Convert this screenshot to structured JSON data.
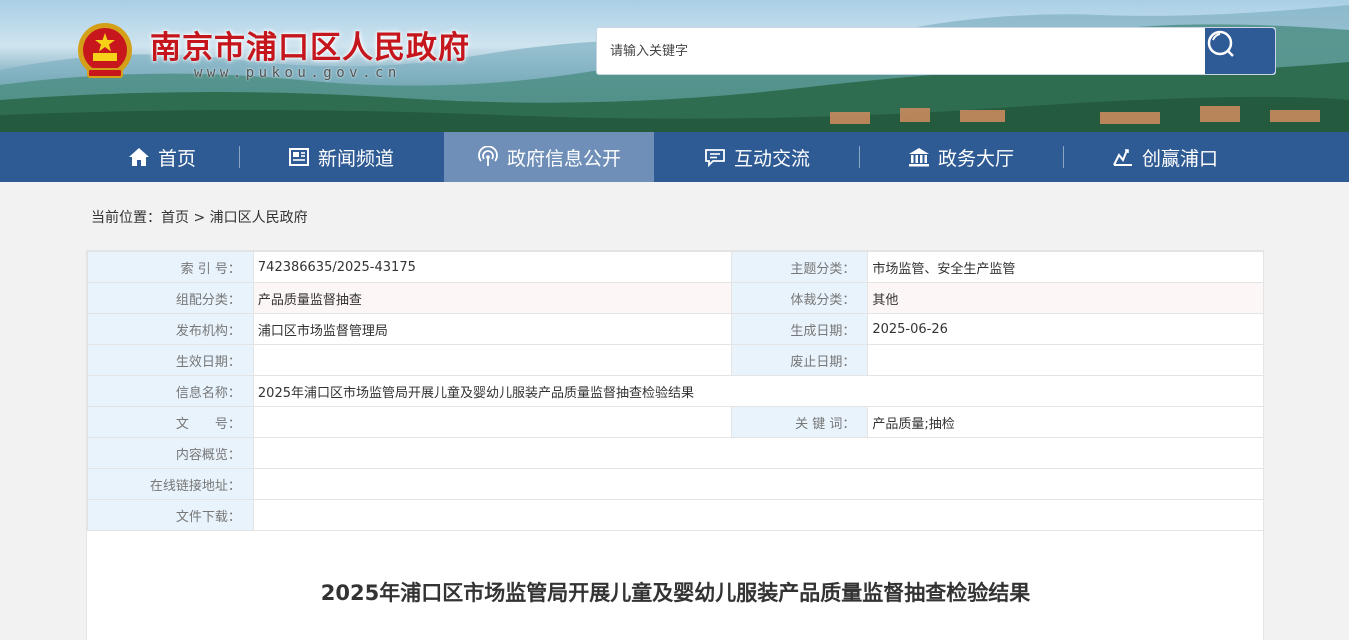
{
  "header": {
    "site_title": "南京市浦口区人民政府",
    "site_domain": "www.pukou.gov.cn",
    "search_placeholder": "请输入关键字"
  },
  "nav": {
    "items": [
      {
        "label": "首页",
        "icon": "home-icon"
      },
      {
        "label": "新闻频道",
        "icon": "news-icon"
      },
      {
        "label": "政府信息公开",
        "icon": "broadcast-icon",
        "active": true
      },
      {
        "label": "互动交流",
        "icon": "chat-icon"
      },
      {
        "label": "政务大厅",
        "icon": "hall-icon"
      },
      {
        "label": "创赢浦口",
        "icon": "growth-icon"
      }
    ]
  },
  "breadcrumb": {
    "prefix": "当前位置：",
    "home": "首页",
    "separator": " > ",
    "current": "浦口区人民政府"
  },
  "info_table": {
    "index_label": "索 引 号：",
    "index_value": "742386635/2025-43175",
    "topic_label": "主题分类：",
    "topic_value": "市场监管、安全生产监管",
    "category_label": "组配分类：",
    "category_value": "产品质量监督抽查",
    "genre_label": "体裁分类：",
    "genre_value": "其他",
    "publisher_label": "发布机构：",
    "publisher_value": "浦口区市场监督管理局",
    "created_label": "生成日期：",
    "created_value": "2025-06-26",
    "effective_label": "生效日期：",
    "effective_value": "",
    "expiry_label": "废止日期：",
    "expiry_value": "",
    "name_label": "信息名称：",
    "name_value": "2025年浦口区市场监管局开展儿童及婴幼儿服装产品质量监督抽查检验结果",
    "docno_label": "文　　号：",
    "docno_value": "",
    "keywords_label": "关 键 词：",
    "keywords_value": "产品质量;抽检",
    "summary_label": "内容概览：",
    "summary_value": "",
    "link_label": "在线链接地址：",
    "link_value": "",
    "download_label": "文件下载：",
    "download_value": ""
  },
  "article": {
    "title": "2025年浦口区市场监管局开展儿童及婴幼儿服装产品质量监督抽查检验结果"
  },
  "colors": {
    "nav_bg": "#2f5b95",
    "nav_active": "#6f8fb8",
    "title_red": "#c4161c",
    "label_bg": "#e8f3fc"
  }
}
